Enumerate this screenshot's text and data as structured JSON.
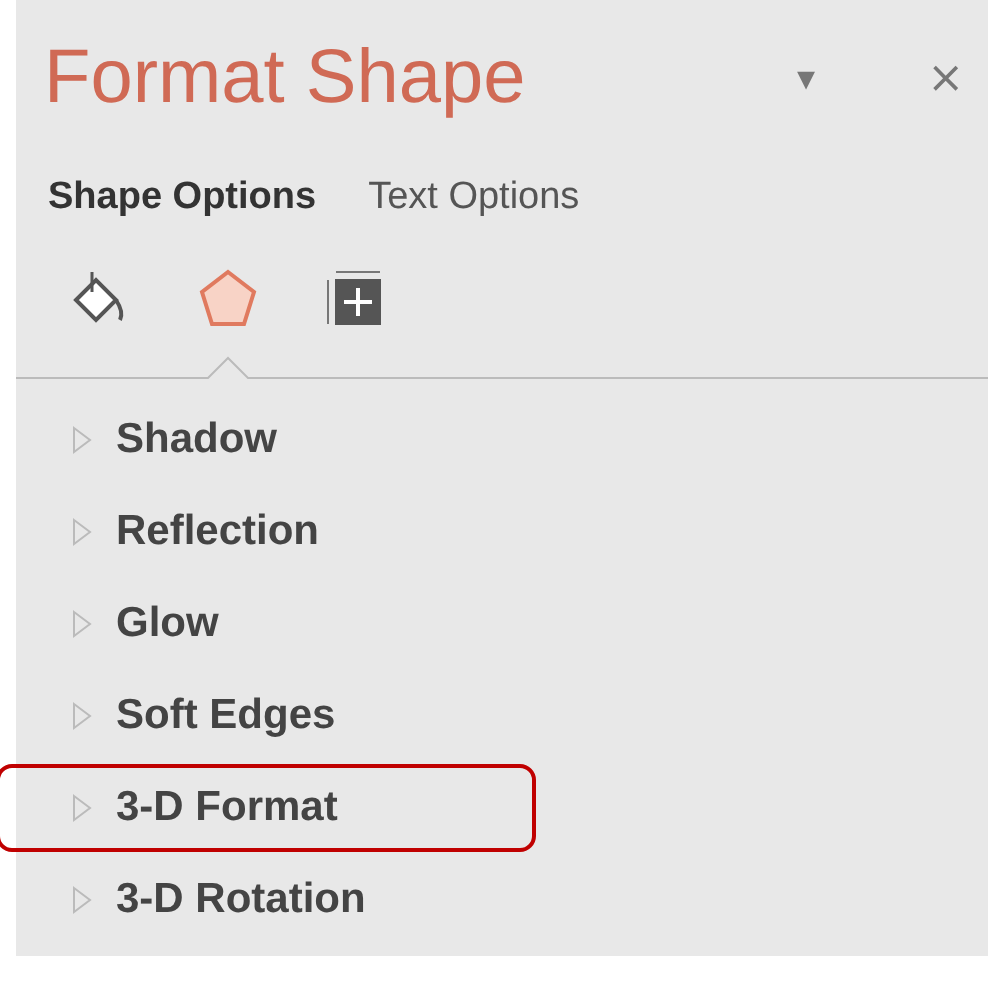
{
  "panel": {
    "title": "Format Shape",
    "dropdown": "▾",
    "close": "×"
  },
  "option_tabs": [
    {
      "label": "Shape Options",
      "selected": true
    },
    {
      "label": "Text Options",
      "selected": false
    }
  ],
  "icon_tabs": [
    {
      "kind": "fill",
      "selected": false
    },
    {
      "kind": "effects",
      "selected": true
    },
    {
      "kind": "size",
      "selected": false
    }
  ],
  "sections": [
    {
      "label": "Shadow",
      "expanded": false,
      "highlighted": false
    },
    {
      "label": "Reflection",
      "expanded": false,
      "highlighted": false
    },
    {
      "label": "Glow",
      "expanded": false,
      "highlighted": false
    },
    {
      "label": "Soft Edges",
      "expanded": false,
      "highlighted": false
    },
    {
      "label": "3-D Format",
      "expanded": false,
      "highlighted": true
    },
    {
      "label": "3-D Rotation",
      "expanded": false,
      "highlighted": false
    }
  ]
}
